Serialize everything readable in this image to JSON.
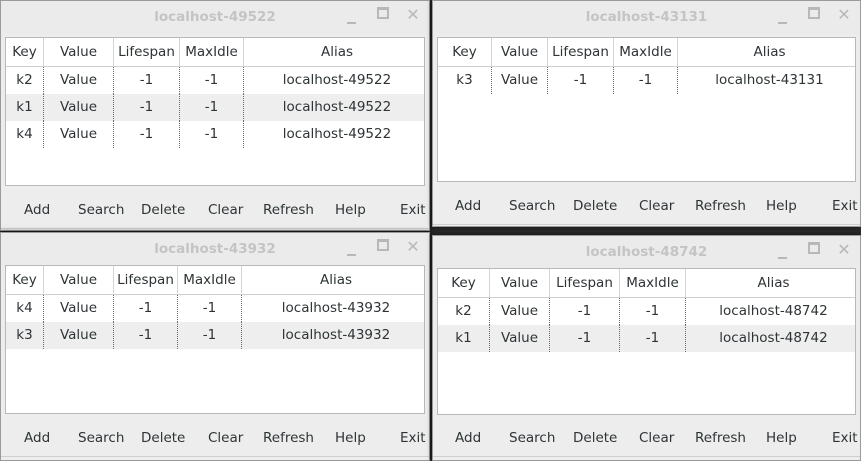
{
  "columns": [
    "Key",
    "Value",
    "Lifespan",
    "MaxIdle",
    "Alias"
  ],
  "buttons": [
    "Add",
    "Search",
    "Delete",
    "Clear",
    "Refresh",
    "Help",
    "Exit"
  ],
  "window_controls": {
    "minimize_icon": "minimize-icon",
    "maximize_icon": "maximize-icon",
    "close_icon": "close-icon",
    "close_glyph": "✕"
  },
  "windows": [
    {
      "title": "localhost-49522",
      "rows": [
        {
          "key": "k2",
          "value": "Value",
          "lifespan": "-1",
          "maxidle": "-1",
          "alias": "localhost-49522"
        },
        {
          "key": "k1",
          "value": "Value",
          "lifespan": "-1",
          "maxidle": "-1",
          "alias": "localhost-49522"
        },
        {
          "key": "k4",
          "value": "Value",
          "lifespan": "-1",
          "maxidle": "-1",
          "alias": "localhost-49522"
        }
      ]
    },
    {
      "title": "localhost-43131",
      "rows": [
        {
          "key": "k3",
          "value": "Value",
          "lifespan": "-1",
          "maxidle": "-1",
          "alias": "localhost-43131"
        }
      ]
    },
    {
      "title": "localhost-43932",
      "rows": [
        {
          "key": "k4",
          "value": "Value",
          "lifespan": "-1",
          "maxidle": "-1",
          "alias": "localhost-43932"
        },
        {
          "key": "k3",
          "value": "Value",
          "lifespan": "-1",
          "maxidle": "-1",
          "alias": "localhost-43932"
        }
      ]
    },
    {
      "title": "localhost-48742",
      "rows": [
        {
          "key": "k2",
          "value": "Value",
          "lifespan": "-1",
          "maxidle": "-1",
          "alias": "localhost-48742"
        },
        {
          "key": "k1",
          "value": "Value",
          "lifespan": "-1",
          "maxidle": "-1",
          "alias": "localhost-48742"
        }
      ]
    }
  ]
}
